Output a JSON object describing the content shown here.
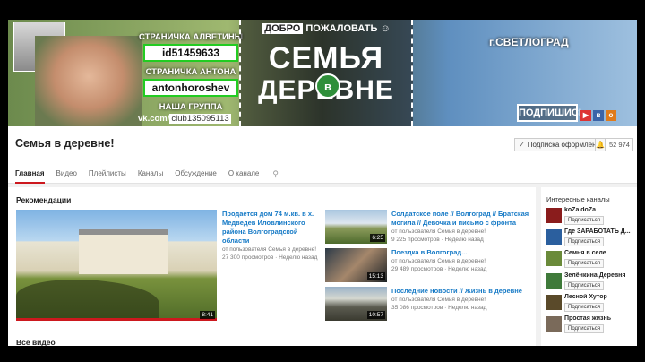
{
  "banner": {
    "info1": "СТРАНИЧКА АЛВЕТИНЫ",
    "id": "id51459633",
    "info2": "СТРАНИЧКА АНТОНА",
    "login": "antonhoroshev",
    "info3": "НАША ГРУППА",
    "vk_prefix": "vk.com/",
    "vk_club": "club135095113",
    "welcome_a": "ДОБРО",
    "welcome_b": "ПОЖАЛОВАТЬ",
    "title_top": "СЕМЬЯ",
    "title_mid": "в",
    "title_bottom": "ДЕРЕВНЕ",
    "city": "г.СВЕТЛОГРАД",
    "subscribe": "ПОДПИШИСЬ"
  },
  "channel": {
    "title": "Семья в деревне!",
    "subscribed_label": "Подписка оформлена",
    "sub_count": "52 974",
    "tabs": [
      "Главная",
      "Видео",
      "Плейлисты",
      "Каналы",
      "Обсуждение",
      "О канале"
    ]
  },
  "main": {
    "rec_title": "Рекомендации",
    "featured": {
      "title": "Продается дом 74 м.кв. в х. Медведев Иловлинского района Волгоградской области",
      "author": "от пользователя Семья в деревне!",
      "views": "27 300 просмотров",
      "age": "Неделю назад",
      "duration": "8:41"
    },
    "videos": [
      {
        "title": "Солдатское поле // Волгоград // Братская могила // Девочка и письмо с фронта",
        "author": "от пользователя Семья в деревне!",
        "views": "9 225 просмотров",
        "age": "Неделю назад",
        "duration": "6:25"
      },
      {
        "title": "Поездка в Волгоград...",
        "author": "от пользователя Семья в деревне!",
        "views": "29 489 просмотров",
        "age": "Неделю назад",
        "duration": "15:13"
      },
      {
        "title": "Последние новости // Жизнь в деревне",
        "author": "от пользователя Семья в деревне!",
        "views": "35 086 просмотров",
        "age": "Неделю назад",
        "duration": "10:57"
      }
    ],
    "all_title": "Все видео"
  },
  "sidebar": {
    "title": "Интересные каналы",
    "subscribe_label": "Подписаться",
    "channels": [
      {
        "name": "koZa doZa",
        "color": "#8a1c1c"
      },
      {
        "name": "Где ЗАРАБОТАТЬ Д...",
        "color": "#2b5f9e"
      },
      {
        "name": "Семья в селе",
        "color": "#6a8a3a"
      },
      {
        "name": "Зелёнкина Деревня",
        "color": "#3f7a3a"
      },
      {
        "name": "Лесной Хутор",
        "color": "#5a4a2a"
      },
      {
        "name": "Простая жизнь",
        "color": "#7a6a5a"
      }
    ]
  }
}
